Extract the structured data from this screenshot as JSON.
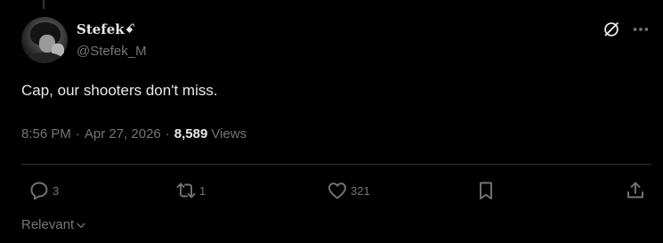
{
  "colors": {
    "background": "#000000",
    "primary_text": "#e7e9ea",
    "secondary_text": "#71767b",
    "divider": "#2f3336"
  },
  "author": {
    "display_name": "Stefek",
    "name_glyph": "ꗃ",
    "handle": "@Stefek_M",
    "avatar_icon": "profile-photo"
  },
  "header_actions": {
    "grok_icon": "grok-icon",
    "more_icon": "more-icon"
  },
  "tweet": {
    "text": "Cap, our shooters don't miss."
  },
  "meta": {
    "time": "8:56 PM",
    "separator": "·",
    "date": "Apr 27, 2026",
    "views_count": "8,589",
    "views_label": "Views"
  },
  "actions": {
    "reply": {
      "icon": "reply-icon",
      "count": "3"
    },
    "repost": {
      "icon": "repost-icon",
      "count": "1"
    },
    "like": {
      "icon": "heart-icon",
      "count": "321"
    },
    "bookmark": {
      "icon": "bookmark-icon"
    },
    "share": {
      "icon": "share-icon"
    }
  },
  "sort": {
    "label": "Relevant",
    "icon": "chevron-down-icon"
  }
}
